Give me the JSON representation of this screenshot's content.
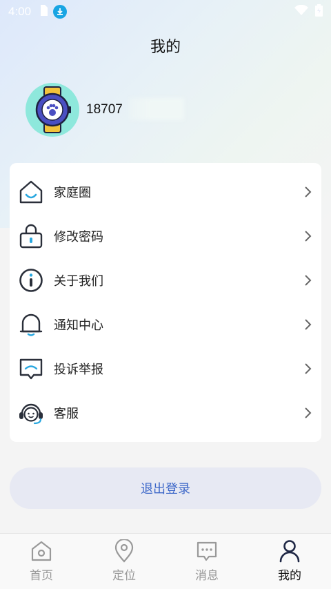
{
  "status_bar": {
    "time": "4:00"
  },
  "header": {
    "title": "我的"
  },
  "profile": {
    "phone": "18707"
  },
  "menu": [
    {
      "label": "家庭圈",
      "icon": "home-icon"
    },
    {
      "label": "修改密码",
      "icon": "lock-icon"
    },
    {
      "label": "关于我们",
      "icon": "info-icon"
    },
    {
      "label": "通知中心",
      "icon": "bell-icon"
    },
    {
      "label": "投诉举报",
      "icon": "report-icon"
    },
    {
      "label": "客服",
      "icon": "headset-icon"
    }
  ],
  "logout": {
    "label": "退出登录"
  },
  "tabbar": [
    {
      "label": "首页",
      "icon": "home-tab-icon",
      "active": false
    },
    {
      "label": "定位",
      "icon": "location-pin-icon",
      "active": false
    },
    {
      "label": "消息",
      "icon": "message-icon",
      "active": false
    },
    {
      "label": "我的",
      "icon": "person-icon",
      "active": true
    }
  ],
  "colors": {
    "accent": "#3b66c8",
    "avatar_bg": "#8ee8dc",
    "icon_stroke": "#2a2f3a",
    "icon_accent": "#2aa8e0"
  }
}
